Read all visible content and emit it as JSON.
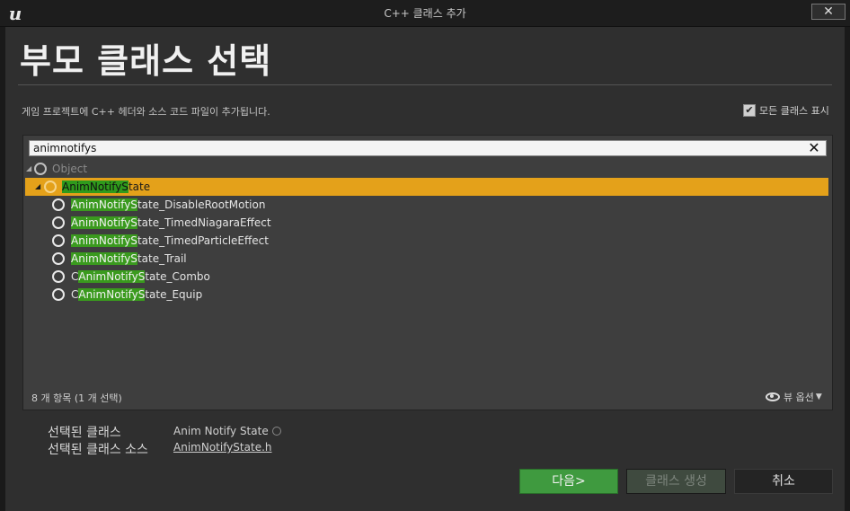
{
  "window": {
    "title": "C++ 클래스 추가",
    "close_label": "✕"
  },
  "heading": "부모 클래스 선택",
  "description": "게임 프로젝트에 C++ 헤더와 소스 코드 파일이 추가됩니다.",
  "show_all": {
    "label": "모든 클래스 표시",
    "checked": true,
    "check_mark": "✔"
  },
  "search": {
    "value": "animnotifys",
    "clear": "✕"
  },
  "tree": {
    "root": {
      "label": "Object"
    },
    "selected": {
      "match": "AnimNotifyS",
      "rest": "tate"
    },
    "children": [
      {
        "pre": "",
        "match": "AnimNotifyS",
        "rest": "tate_DisableRootMotion"
      },
      {
        "pre": "",
        "match": "AnimNotifyS",
        "rest": "tate_TimedNiagaraEffect"
      },
      {
        "pre": "",
        "match": "AnimNotifyS",
        "rest": "tate_TimedParticleEffect"
      },
      {
        "pre": "",
        "match": "AnimNotifyS",
        "rest": "tate_Trail"
      },
      {
        "pre": "C",
        "match": "AnimNotifyS",
        "rest": "tate_Combo"
      },
      {
        "pre": "C",
        "match": "AnimNotifyS",
        "rest": "tate_Equip"
      }
    ]
  },
  "status": {
    "count": "8 개 항목 (1 개 선택)",
    "view_options": "뷰 옵션"
  },
  "selected_info": {
    "class_label": "선택된 클래스",
    "class_value": "Anim Notify State",
    "source_label": "선택된 클래스 소스",
    "source_value": "AnimNotifyState.h"
  },
  "buttons": {
    "next": "다음>",
    "create": "클래스 생성",
    "cancel": "취소"
  },
  "colors": {
    "selection": "#e4a11a",
    "match_highlight": "#3a9a1e",
    "next_button": "#3f9a3f"
  }
}
